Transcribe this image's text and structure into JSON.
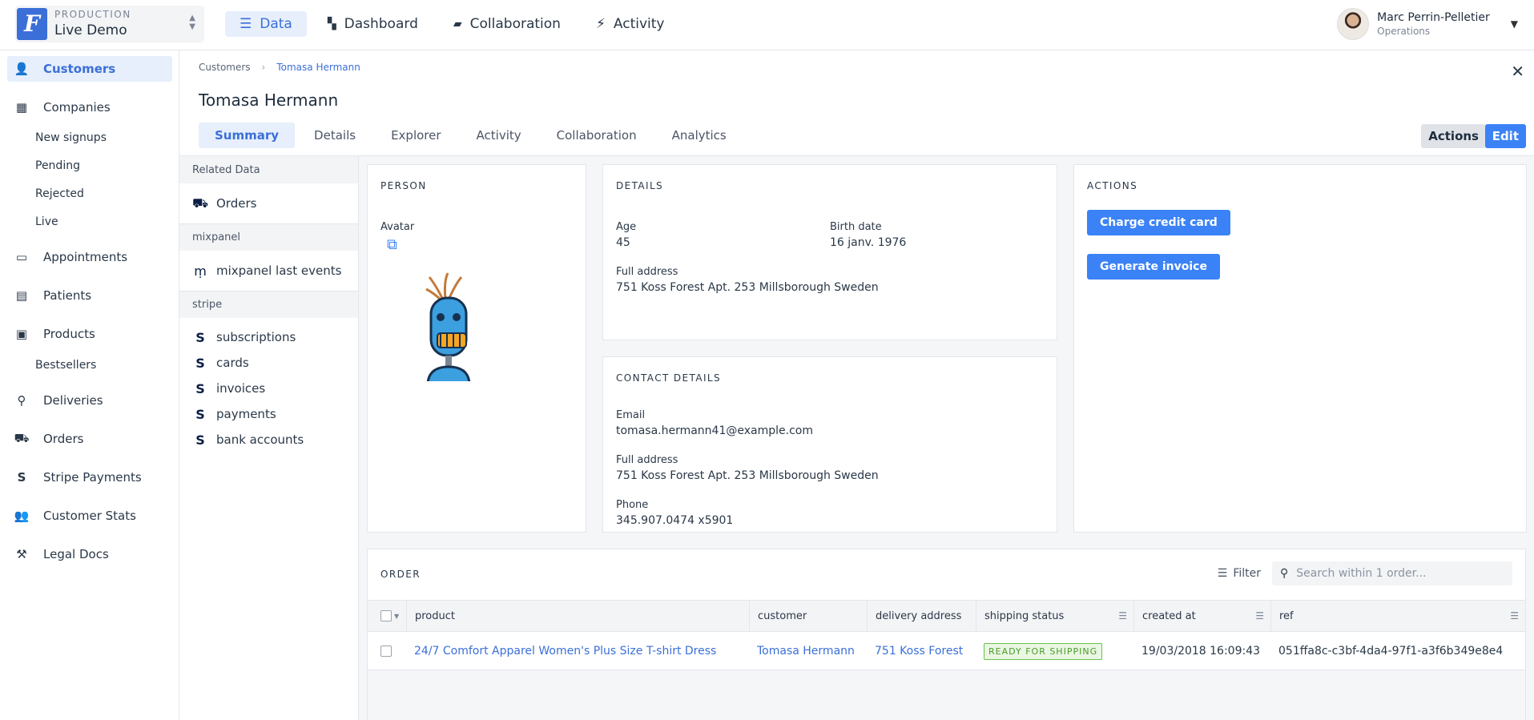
{
  "app": {
    "env_label": "PRODUCTION",
    "env_name": "Live Demo",
    "logo_letter": "F",
    "accent_color": "#3b6fd8"
  },
  "topnav": [
    {
      "label": "Data",
      "icon": "list-icon",
      "active": true
    },
    {
      "label": "Dashboard",
      "icon": "dashboard-icon",
      "active": false
    },
    {
      "label": "Collaboration",
      "icon": "chat-icon",
      "active": false
    },
    {
      "label": "Activity",
      "icon": "bolt-icon",
      "active": false
    }
  ],
  "user": {
    "name": "Marc Perrin-Pelletier",
    "role": "Operations"
  },
  "sidebar": {
    "items": [
      {
        "label": "Customers",
        "icon": "user-icon",
        "active": true
      },
      {
        "label": "Companies",
        "icon": "building-icon"
      },
      {
        "label": "Appointments",
        "icon": "calendar-icon"
      },
      {
        "label": "Patients",
        "icon": "id-card-icon"
      },
      {
        "label": "Products",
        "icon": "box-icon"
      },
      {
        "label": "Deliveries",
        "icon": "map-pin-icon"
      },
      {
        "label": "Orders",
        "icon": "basket-icon"
      },
      {
        "label": "Stripe Payments",
        "icon": "stripe-icon"
      },
      {
        "label": "Customer Stats",
        "icon": "users-icon"
      },
      {
        "label": "Legal Docs",
        "icon": "gavel-icon"
      }
    ],
    "companies_sub": [
      "New signups",
      "Pending",
      "Rejected",
      "Live"
    ],
    "products_sub": [
      "Bestsellers"
    ]
  },
  "breadcrumb": {
    "root": "Customers",
    "current": "Tomasa Hermann"
  },
  "page_title": "Tomasa Hermann",
  "tabs": [
    {
      "label": "Summary",
      "active": true
    },
    {
      "label": "Details"
    },
    {
      "label": "Explorer"
    },
    {
      "label": "Activity"
    },
    {
      "label": "Collaboration"
    },
    {
      "label": "Analytics"
    }
  ],
  "header_buttons": {
    "actions": "Actions",
    "edit": "Edit"
  },
  "related": {
    "sections": [
      {
        "title": "Related Data",
        "items": [
          {
            "label": "Orders",
            "icon": "basket-icon"
          }
        ]
      },
      {
        "title": "mixpanel",
        "items": [
          {
            "label": "mixpanel last events",
            "icon": "mixpanel-icon"
          }
        ]
      },
      {
        "title": "stripe",
        "items": [
          {
            "label": "subscriptions",
            "icon": "stripe-icon"
          },
          {
            "label": "cards",
            "icon": "stripe-icon"
          },
          {
            "label": "invoices",
            "icon": "stripe-icon"
          },
          {
            "label": "payments",
            "icon": "stripe-icon"
          },
          {
            "label": "bank accounts",
            "icon": "stripe-icon"
          }
        ]
      }
    ]
  },
  "person": {
    "title": "PERSON",
    "avatar_label": "Avatar"
  },
  "details": {
    "title": "DETAILS",
    "age_label": "Age",
    "age": "45",
    "birth_label": "Birth date",
    "birth": "16 janv. 1976",
    "address_label": "Full address",
    "address": "751 Koss Forest Apt. 253 Millsborough Sweden"
  },
  "contact": {
    "title": "CONTACT DETAILS",
    "email_label": "Email",
    "email": "tomasa.hermann41@example.com",
    "address_label": "Full address",
    "address": "751 Koss Forest Apt. 253 Millsborough Sweden",
    "phone_label": "Phone",
    "phone": "345.907.0474 x5901"
  },
  "actions_card": {
    "title": "ACTIONS",
    "charge": "Charge credit card",
    "invoice": "Generate invoice"
  },
  "order": {
    "title": "ORDER",
    "filter": "Filter",
    "search_placeholder": "Search within 1 order...",
    "columns": [
      "product",
      "customer",
      "delivery address",
      "shipping status",
      "created at",
      "ref"
    ],
    "row": {
      "product": "24/7 Comfort Apparel Women's Plus Size T-shirt Dress",
      "customer": "Tomasa Hermann",
      "delivery": "751 Koss Forest",
      "status": "READY FOR SHIPPING",
      "created": "19/03/2018 16:09:43",
      "ref": "051ffa8c-c3bf-4da4-97f1-a3f6b349e8e4"
    },
    "status_color": "#6cc04a"
  }
}
